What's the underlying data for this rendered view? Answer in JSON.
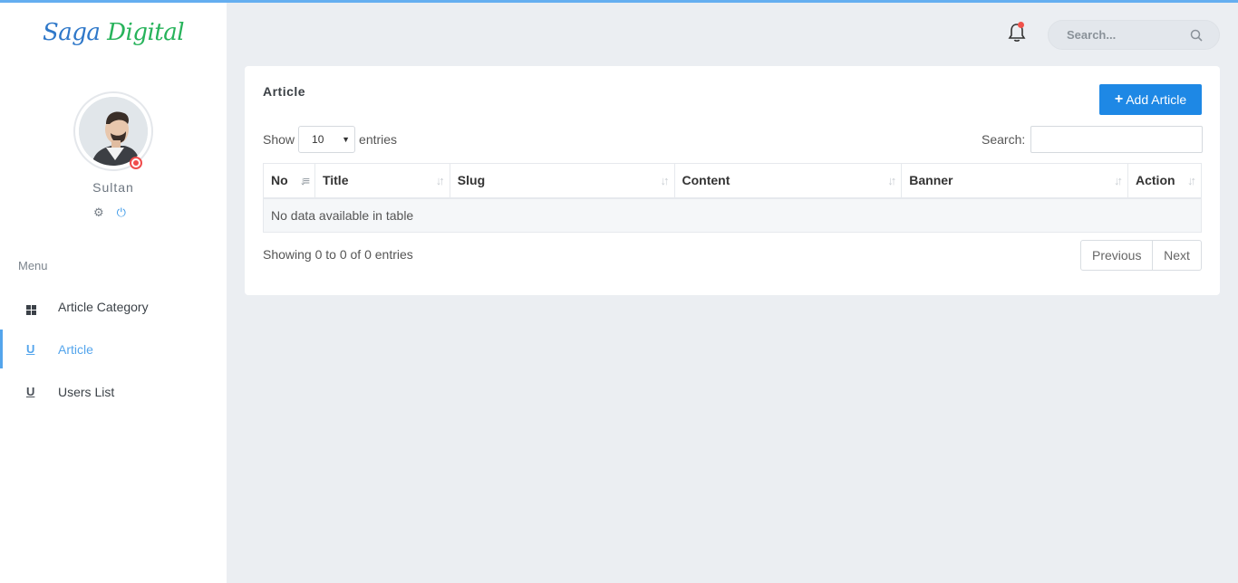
{
  "brand": {
    "part1": "Saga",
    "part2": "Digital"
  },
  "user": {
    "name": "Sultan",
    "status_color": "#f04b4b"
  },
  "sidebar": {
    "menu_title": "Menu",
    "items": [
      {
        "label": "Article Category",
        "icon": "dashboard-icon",
        "active": false
      },
      {
        "label": "Article",
        "icon": "underline-icon",
        "active": true
      },
      {
        "label": "Users List",
        "icon": "underline-icon",
        "active": false
      }
    ]
  },
  "header": {
    "search_placeholder": "Search...",
    "notification_icon": "bell-icon"
  },
  "card": {
    "title": "Article",
    "add_button": "Add Article",
    "length": {
      "prefix": "Show",
      "value": "10",
      "suffix": "entries"
    },
    "filter_label": "Search:",
    "columns": [
      "No",
      "Title",
      "Slug",
      "Content",
      "Banner",
      "Action"
    ],
    "empty_text": "No data available in table",
    "info": "Showing 0 to 0 of 0 entries",
    "pager": {
      "previous": "Previous",
      "next": "Next"
    }
  },
  "colors": {
    "accent": "#1e88e5",
    "active_menu": "#54a5ec",
    "brand_blue": "#2f78c9",
    "brand_green": "#27b35b"
  }
}
